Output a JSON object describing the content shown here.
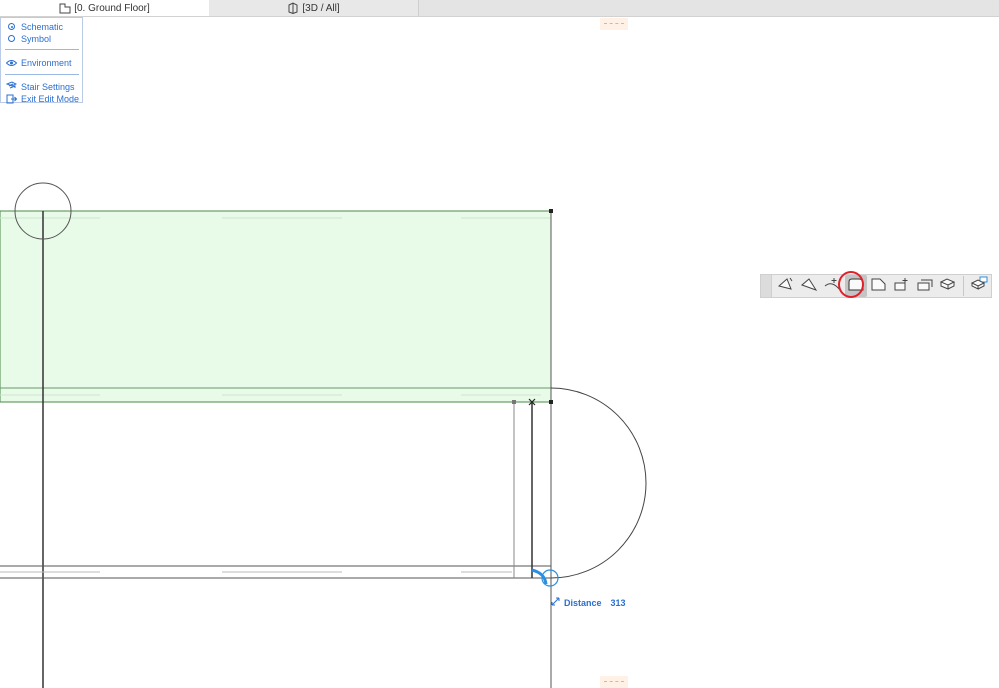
{
  "tabs": [
    {
      "label": "[0. Ground Floor]",
      "icon": "floor-plan-icon",
      "active": true
    },
    {
      "label": "[3D / All]",
      "icon": "3d-view-icon",
      "active": false
    }
  ],
  "panel": {
    "schematic": "Schematic",
    "symbol": "Symbol",
    "environment": "Environment",
    "stair_settings": "Stair Settings",
    "exit_edit_mode": "Exit Edit Mode",
    "selected_view": "Schematic"
  },
  "toolbar": {
    "tools": [
      "straight-segment-icon",
      "turning-segment-icon",
      "curved-segment-icon",
      "landing-shape-icon",
      "landing-corner-icon",
      "landing-edit-icon",
      "landing-offset-icon",
      "stair-3d-icon",
      "stair-settings-icon"
    ],
    "highlighted_tool": "landing-shape-icon"
  },
  "readout": {
    "label": "Distance",
    "value": "313"
  },
  "colors": {
    "accent": "#2a6fd1",
    "selection_fill": "#e8fbe8",
    "selection_stroke": "#4a8a4a",
    "highlight_ring": "#e0202a",
    "marker": "#f0b07a"
  }
}
